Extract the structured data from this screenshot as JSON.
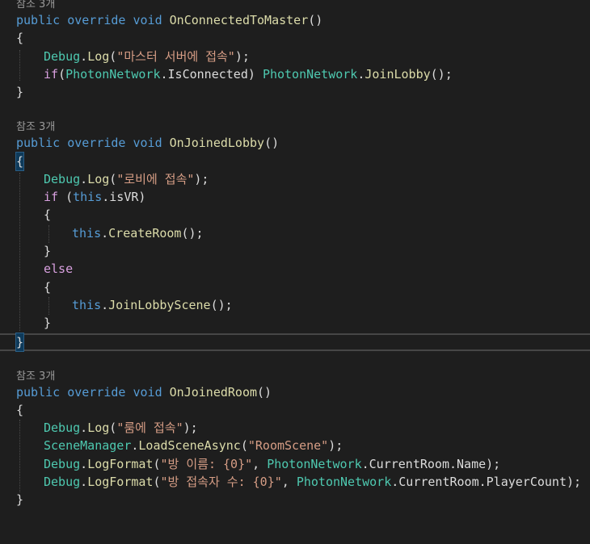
{
  "editor": {
    "theme": {
      "background": "#1e1e1e",
      "keyword": "#569cd6",
      "type": "#4ec9b0",
      "method": "#dcdcaa",
      "string": "#d69d85",
      "control": "#d8a0df",
      "text": "#dcdcdc",
      "codelens": "#9a9a9a"
    },
    "blocks": [
      {
        "references": "참조 3개",
        "signature": {
          "mod1": "public",
          "mod2": "override",
          "ret": "void",
          "name": "OnConnectedToMaster",
          "parens": "()"
        },
        "open": "{",
        "lines": [
          {
            "a": "Debug",
            "b": ".",
            "c": "Log",
            "d": "(",
            "e": "\"마스터 서버에 접속\"",
            "f": ");"
          },
          {
            "a": "if",
            "b": "(",
            "c": "PhotonNetwork",
            "d": ".IsConnected) ",
            "e": "PhotonNetwork",
            "f": ".",
            "g": "JoinLobby",
            "h": "();"
          }
        ],
        "close": "}"
      },
      {
        "references": "참조 3개",
        "signature": {
          "mod1": "public",
          "mod2": "override",
          "ret": "void",
          "name": "OnJoinedLobby",
          "parens": "()"
        },
        "open": "{",
        "lines": [
          {
            "a": "Debug",
            "b": ".",
            "c": "Log",
            "d": "(",
            "e": "\"로비에 접속\"",
            "f": ");"
          },
          {
            "a": "if",
            "b": " (",
            "c": "this",
            "d": ".isVR)"
          },
          {
            "a": "{"
          },
          {
            "a": "this",
            "b": ".",
            "c": "CreateRoom",
            "d": "();"
          },
          {
            "a": "}"
          },
          {
            "a": "else"
          },
          {
            "a": "{"
          },
          {
            "a": "this",
            "b": ".",
            "c": "JoinLobbyScene",
            "d": "();"
          },
          {
            "a": "}"
          }
        ],
        "close": "}"
      },
      {
        "references": "참조 3개",
        "signature": {
          "mod1": "public",
          "mod2": "override",
          "ret": "void",
          "name": "OnJoinedRoom",
          "parens": "()"
        },
        "open": "{",
        "lines": [
          {
            "a": "Debug",
            "b": ".",
            "c": "Log",
            "d": "(",
            "e": "\"룸에 접속\"",
            "f": ");"
          },
          {
            "a": "SceneManager",
            "b": ".",
            "c": "LoadSceneAsync",
            "d": "(",
            "e": "\"RoomScene\"",
            "f": ");"
          },
          {
            "a": "Debug",
            "b": ".",
            "c": "LogFormat",
            "d": "(",
            "e": "\"방 이름: {0}\"",
            "f": ", ",
            "g": "PhotonNetwork",
            "h": ".CurrentRoom.Name);"
          },
          {
            "a": "Debug",
            "b": ".",
            "c": "LogFormat",
            "d": "(",
            "e": "\"방 접속자 수: {0}\"",
            "f": ", ",
            "g": "PhotonNetwork",
            "h": ".CurrentRoom.PlayerCount);"
          }
        ],
        "close": "}"
      }
    ]
  }
}
